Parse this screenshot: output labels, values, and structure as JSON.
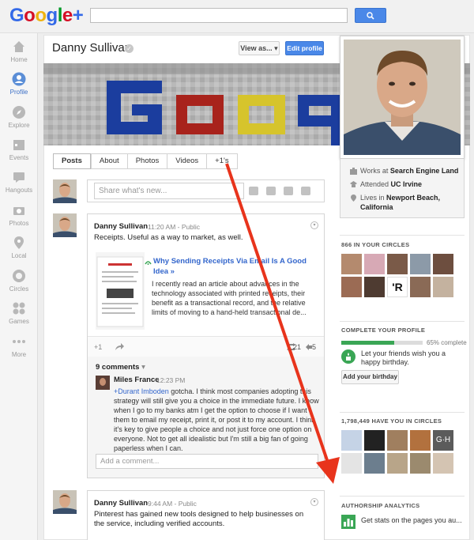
{
  "header": {
    "logo_text": "Google+",
    "search_placeholder": ""
  },
  "nav": {
    "items": [
      {
        "label": "Home"
      },
      {
        "label": "Profile"
      },
      {
        "label": "Explore"
      },
      {
        "label": "Events"
      },
      {
        "label": "Hangouts"
      },
      {
        "label": "Photos"
      },
      {
        "label": "Local"
      },
      {
        "label": "Circles"
      },
      {
        "label": "Games"
      },
      {
        "label": "More"
      }
    ]
  },
  "profile": {
    "name": "Danny Sullivan",
    "view_as": "View as...",
    "edit_profile": "Edit profile",
    "tabs": [
      "Posts",
      "About",
      "Photos",
      "Videos",
      "+1's"
    ],
    "works_prefix": "Works at ",
    "works_at": "Search Engine Land",
    "attended_prefix": "Attended ",
    "attended": "UC Irvine",
    "lives_prefix": "Lives in ",
    "lives_in": "Newport Beach, California"
  },
  "share": {
    "placeholder": "Share what's new..."
  },
  "post1": {
    "author": "Danny Sullivan",
    "time": "11:20 AM",
    "visibility": "Public",
    "text": "Receipts. Useful as a way to market, as well.",
    "link_title": "Why Sending Receipts Via Email Is A Good Idea »",
    "link_desc": "I recently read an article about advances in the technology associated with printed receipts, their benefit as a transactional record, and the relative limits of moving to a hand-held transactional de...",
    "plus_one": "+1",
    "reshares": "21",
    "comments_icon_count": "5"
  },
  "comments": {
    "count_label": "9 comments",
    "commenter": "Miles France",
    "comment_time": "12:23 PM",
    "mention": "+Durant Imboden",
    "comment_text": " gotcha. I think most companies adopting this strategy will still give you a choice in the immediate future. I know when I go to my banks atm I get the option to choose if I want them to email my receipt, print it, or post it to my account. I think it's key to give people a choice and not just force one option on everyone. Not to get all idealistic but I'm still a big fan of going paperless when I can.",
    "add_placeholder": "Add a comment..."
  },
  "post2": {
    "author": "Danny Sullivan",
    "time": "9:44 AM",
    "visibility": "Public",
    "text": "Pinterest has gained new tools designed to help businesses on the service, including verified accounts."
  },
  "right": {
    "in_circles_title": "866 IN YOUR CIRCLES",
    "complete_title": "COMPLETE YOUR PROFILE",
    "complete_percent_label": "65% complete",
    "complete_fraction": 0.65,
    "birthday_prompt": "Let your friends wish you a happy birthday.",
    "birthday_button": "Add your birthday",
    "have_you_title": "1,798,449 HAVE YOU IN CIRCLES",
    "analytics_title": "AUTHORSHIP ANALYTICS",
    "analytics_text": "Get stats on the pages you au..."
  },
  "colors": {
    "accent": "#4a88e8",
    "link": "#3366cc",
    "progress": "#3aa655",
    "arrow": "#e8341c"
  }
}
